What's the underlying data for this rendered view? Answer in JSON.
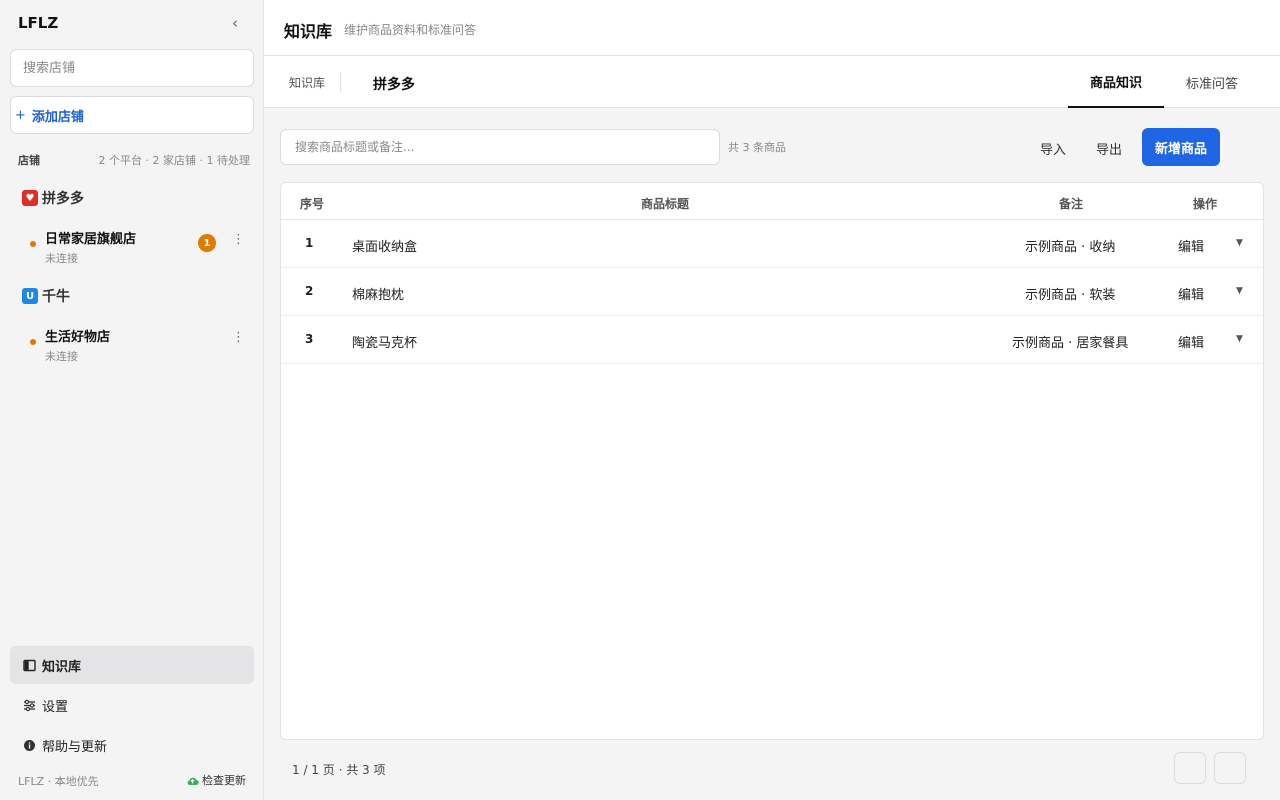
{
  "sidebar": {
    "brand": "LFLZ",
    "collapse_icon": "chevron-left-icon",
    "search_placeholder": "搜索店铺",
    "add_store_label": "添加店铺",
    "section_title": "店铺",
    "section_summary": "2 个平台 · 2 家店铺 · 1 待处理",
    "platforms": [
      {
        "name": "拼多多",
        "icon": "pinduoduo-icon",
        "color": "#e02e24",
        "stores": [
          {
            "name": "日常家居旗舰店",
            "status": "未连接",
            "badge": "1",
            "status_color": "#e07a00"
          }
        ]
      },
      {
        "name": "千牛",
        "icon": "qianniu-icon",
        "color": "#1e88e5",
        "stores": [
          {
            "name": "生活好物店",
            "status": "未连接",
            "badge": "",
            "status_color": "#e07a00"
          }
        ]
      }
    ],
    "nav": [
      {
        "label": "知识库",
        "icon": "book-icon",
        "active": true
      },
      {
        "label": "设置",
        "icon": "sliders-icon",
        "active": false
      },
      {
        "label": "帮助与更新",
        "icon": "info-icon",
        "active": false
      }
    ],
    "footer_left": "LFLZ · 本地优先",
    "footer_right": "检查更新"
  },
  "header": {
    "title": "知识库",
    "subtitle": "维护商品资料和标准问答"
  },
  "subbar": {
    "crumb_root": "知识库",
    "crumb_current": "拼多多",
    "tabs": [
      {
        "label": "商品知识",
        "active": true
      },
      {
        "label": "标准问答",
        "active": false
      }
    ]
  },
  "toolbar": {
    "search_placeholder": "搜索商品标题或备注...",
    "count": "共 3 条商品",
    "import_label": "导入",
    "export_label": "导出",
    "add_label": "新增商品"
  },
  "table": {
    "columns": [
      "序号",
      "商品标题",
      "备注",
      "操作"
    ],
    "rows": [
      {
        "index": "1",
        "title": "桌面收纳盒",
        "note": "示例商品 · 收纳",
        "action": "编辑"
      },
      {
        "index": "2",
        "title": "棉麻抱枕",
        "note": "示例商品 · 软装",
        "action": "编辑"
      },
      {
        "index": "3",
        "title": "陶瓷马克杯",
        "note": "示例商品 · 居家餐具",
        "action": "编辑"
      }
    ]
  },
  "pager": {
    "text": "1 / 1 页 · 共 3 项"
  },
  "colors": {
    "accent": "#1f66e5",
    "pending": "#e07a00"
  }
}
